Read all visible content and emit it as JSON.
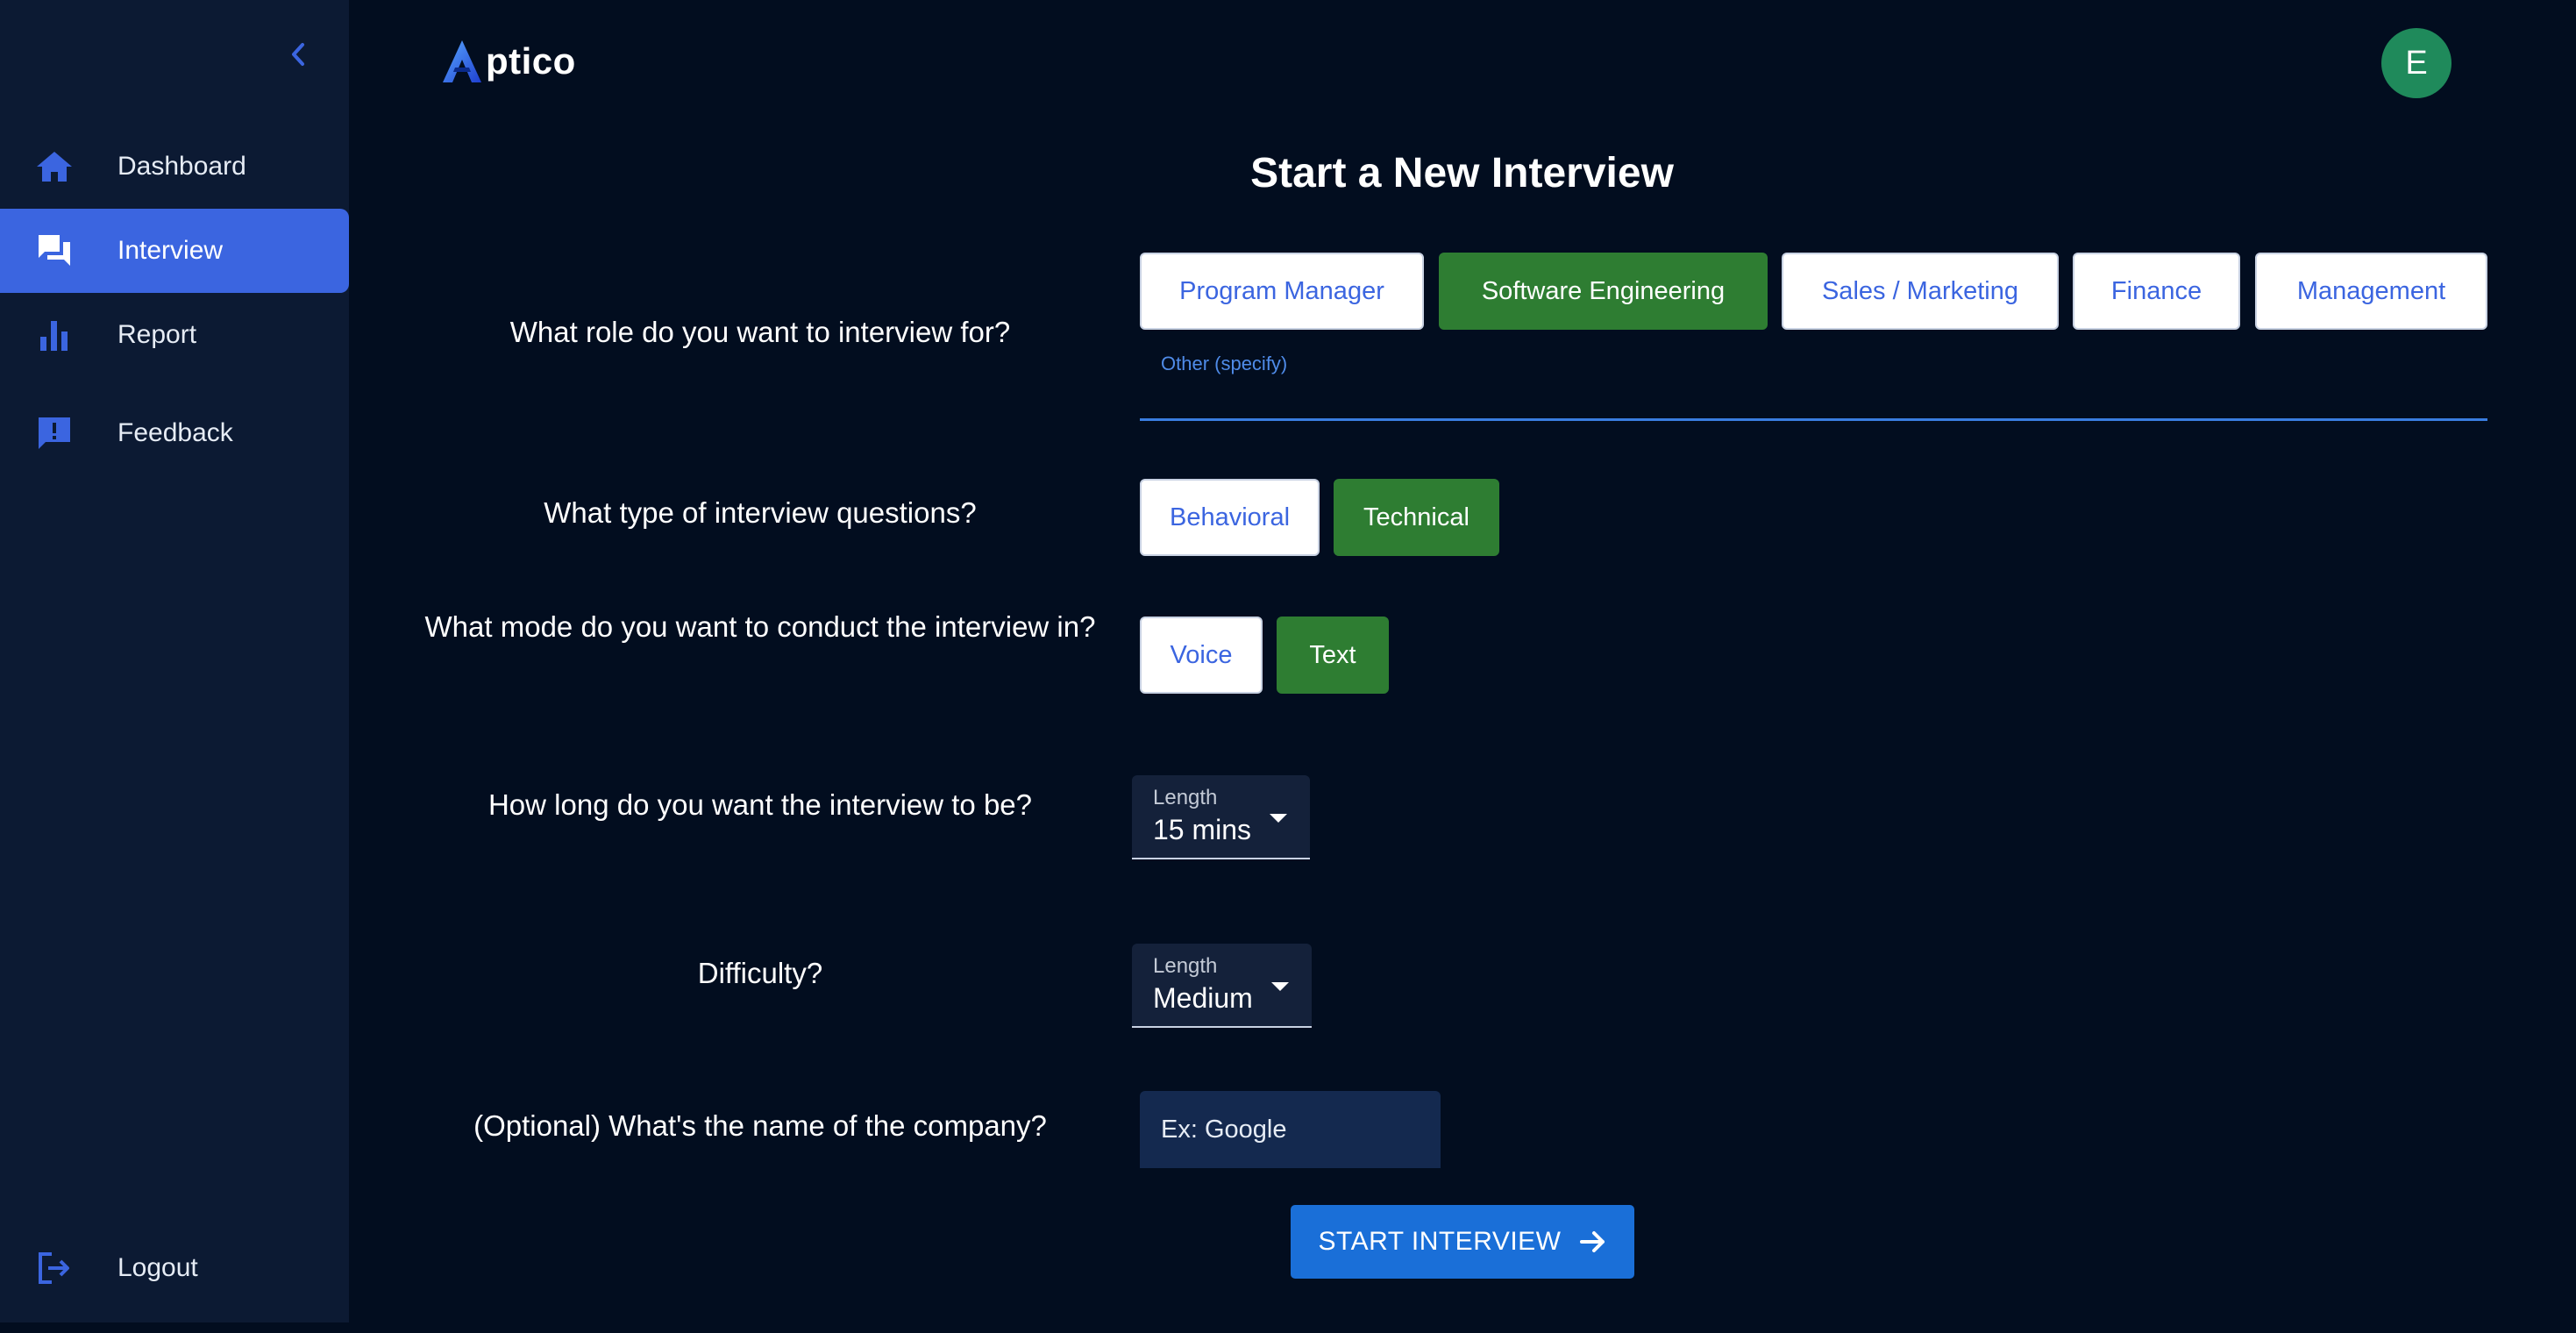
{
  "brand": {
    "logo_letter": "A",
    "name": "ptico",
    "accent": "#3b65e0"
  },
  "sidebar": {
    "items": [
      {
        "label": "Dashboard",
        "icon": "home-icon",
        "active": false
      },
      {
        "label": "Interview",
        "icon": "chat-icon",
        "active": true
      },
      {
        "label": "Report",
        "icon": "bar-chart-icon",
        "active": false
      },
      {
        "label": "Feedback",
        "icon": "feedback-icon",
        "active": false
      }
    ],
    "logout_label": "Logout"
  },
  "user": {
    "avatar_initial": "E",
    "avatar_color": "#1f8a5b"
  },
  "main": {
    "title": "Start a New Interview",
    "role": {
      "question": "What role do you want to interview for?",
      "options": [
        "Program Manager",
        "Software Engineering",
        "Sales / Marketing",
        "Finance",
        "Management"
      ],
      "selected": "Software Engineering",
      "other_label": "Other (specify)"
    },
    "question_type": {
      "question": "What type of interview questions?",
      "options": [
        "Behavioral",
        "Technical"
      ],
      "selected": "Technical"
    },
    "mode": {
      "question": "What mode do you want to conduct the interview in?",
      "options": [
        "Voice",
        "Text"
      ],
      "selected": "Text"
    },
    "length": {
      "question": "How long do you want the interview to be?",
      "select_label": "Length",
      "value": "15 mins"
    },
    "difficulty": {
      "question": "Difficulty?",
      "select_label": "Length",
      "value": "Medium"
    },
    "company": {
      "question": "(Optional) What's the name of the company?",
      "placeholder": "Ex: Google",
      "value": ""
    },
    "start_button": "START INTERVIEW"
  }
}
